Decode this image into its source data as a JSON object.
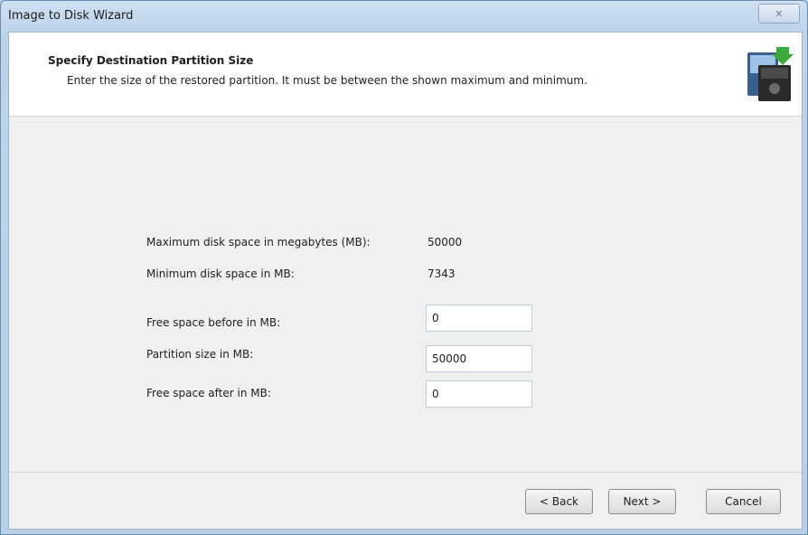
{
  "window": {
    "title": "Image to Disk Wizard",
    "close_glyph": "✕"
  },
  "header": {
    "title": "Specify Destination Partition Size",
    "subtitle": "Enter the size of the restored partition. It must be between the shown maximum and minimum.",
    "icon": "disk-wizard-icon"
  },
  "info": {
    "max_label": "Maximum disk space in megabytes (MB):",
    "max_value": "50000",
    "min_label": "Minimum disk space in MB:",
    "min_value": "7343"
  },
  "fields": {
    "free_before_label": "Free space before in MB:",
    "free_before_value": "0",
    "partition_size_label": "Partition size in MB:",
    "partition_size_value": "50000",
    "free_after_label": "Free space after in MB:",
    "free_after_value": "0"
  },
  "buttons": {
    "back": "< Back",
    "next": "Next >",
    "cancel": "Cancel"
  }
}
